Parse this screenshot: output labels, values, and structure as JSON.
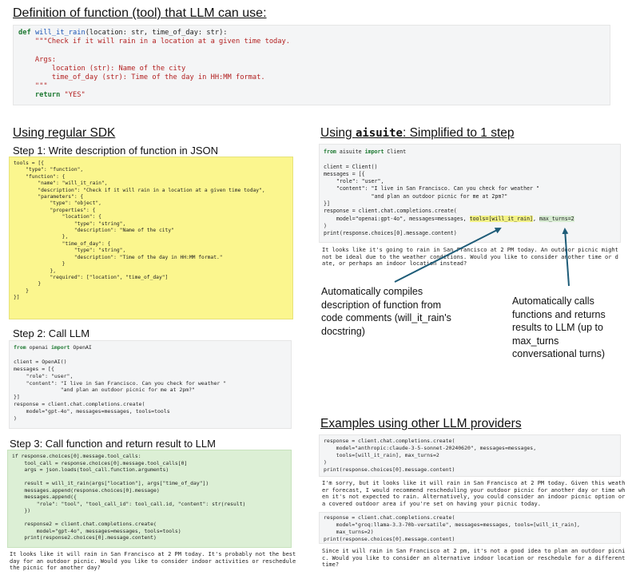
{
  "definition": {
    "title": "Definition of function (tool) that LLM can use:",
    "code": {
      "kw_def": "def",
      "fn_name": "will_it_rain",
      "signature": "(location: str, time_of_day: str):",
      "docstring_first": "\"\"\"Check if it will rain in a location at a given time today.",
      "args_header": "Args:",
      "arg1": "location (str): Name of the city",
      "arg2": "time_of_day (str): Time of the day in HH:MM format.",
      "docstring_close": "\"\"\"",
      "kw_return": "return",
      "return_value": "\"YES\""
    }
  },
  "regular_sdk": {
    "title": "Using regular SDK",
    "step1": "Step 1: Write description of function in JSON",
    "step1_code": "tools = [{\n    \"type\": \"function\",\n    \"function\": {\n        \"name\": \"will_it_rain\",\n        \"description\": \"Check if it will rain in a location at a given time today\",\n        \"parameters\": {\n            \"type\": \"object\",\n            \"properties\": {\n                \"location\": {\n                    \"type\": \"string\",\n                    \"description\": \"Name of the city\"\n                },\n                \"time_of_day\": {\n                    \"type\": \"string\",\n                    \"description\": \"Time of the day in HH:MM format.\"\n                }\n            },\n            \"required\": [\"location\", \"time_of_day\"]\n        }\n    }\n}]",
    "step2": "Step 2: Call LLM",
    "step2_import": {
      "kw_from": "from",
      "module": " openai ",
      "kw_import": "import",
      "name": " OpenAI"
    },
    "step2_code": "client = OpenAI()\nmessages = [{\n    \"role\": \"user\",\n    \"content\": \"I live in San Francisco. Can you check for weather \"\n               \"and plan an outdoor picnic for me at 2pm?\"\n}]\nresponse = client.chat.completions.create(\n    model=\"gpt-4o\", messages=messages, tools=tools\n)",
    "step3": "Step 3: Call function and return result to LLM",
    "step3_code": "if response.choices[0].message.tool_calls:\n    tool_call = response.choices[0].message.tool_calls[0]\n    args = json.loads(tool_call.function.arguments)\n\n    result = will_it_rain(args[\"location\"], args[\"time_of_day\"])\n    messages.append(response.choices[0].message)\n    messages.append({\n        \"role\": \"tool\", \"tool_call_id\": tool_call.id, \"content\": str(result)\n    })\n\n    response2 = client.chat.completions.create(\n        model=\"gpt-4o\", messages=messages, tools=tools)\n    print(response2.choices[0].message.content)",
    "step3_output": "It looks like it will rain in San Francisco at 2 PM today. It's probably not the best\nday for an outdoor picnic. Would you like to consider indoor activities or reschedule\nthe picnic for another day?"
  },
  "aisuite": {
    "title_prefix": "Using ",
    "title_mono": "aisuite",
    "title_suffix": ": Simplified to 1 step",
    "import": {
      "kw_from": "from",
      "module": " aisuite ",
      "kw_import": "import",
      "name": " Client"
    },
    "code_top": "client = Client()\nmessages = [{\n    \"role\": \"user\",\n    \"content\": \"I live in San Francisco. Can you check for weather \"\n               \"and plan an outdoor picnic for me at 2pm?\"\n}]\nresponse = client.chat.completions.create(",
    "code_model_line": "    model=\"openai:gpt-4o\", messages=messages, ",
    "code_tools_hl": "tools=[will_it_rain]",
    "code_sep": ", ",
    "code_turns_hl": "max_turns=2",
    "code_bottom": ")\nprint(response.choices[0].message.content)",
    "output": "It looks like it's going to rain in San Francisco at 2 PM today. An outdoor picnic might\nnot be ideal due to the weather conditions. Would you like to consider another time or d\nate, or perhaps an indoor location instead?",
    "note_left": "Automatically compiles\ndescription of function from\ncode comments (will_it_rain's\ndocstring)",
    "note_right": "Automatically calls\nfunctions and returns\nresults to LLM (up to\nmax_turns\nconversational turns)"
  },
  "other_providers": {
    "title": "Examples using other LLM providers",
    "code1": "response = client.chat.completions.create(\n    model=\"anthropic:claude-3-5-sonnet-20240620\", messages=messages,\n    tools=[will_it_rain], max_turns=2\n)\nprint(response.choices[0].message.content)",
    "output1": "I'm sorry, but it looks like it will rain in San Francisco at 2 PM today. Given this weath\ner forecast, I would recommend rescheduling your outdoor picnic for another day or time wh\nen it's not expected to rain. Alternatively, you could consider an indoor picnic option or\na covered outdoor area if you're set on having your picnic today.",
    "code2": "response = client.chat.completions.create(\n    model=\"groq:llama-3.3-70b-versatile\", messages=messages, tools=[will_it_rain],\n    max_turns=2)\nprint(response.choices[0].message.content)",
    "output2": "Since it will rain in San Francisco at 2 pm, it's not a good idea to plan an outdoor picni\nc. Would you like to consider an alternative indoor location or reschedule for a different\ntime?"
  },
  "colors": {
    "yellow": "#fbf68e",
    "green": "#dcefd5",
    "arrow": "#1e5c78",
    "code_bg": "#f4f5f6"
  }
}
